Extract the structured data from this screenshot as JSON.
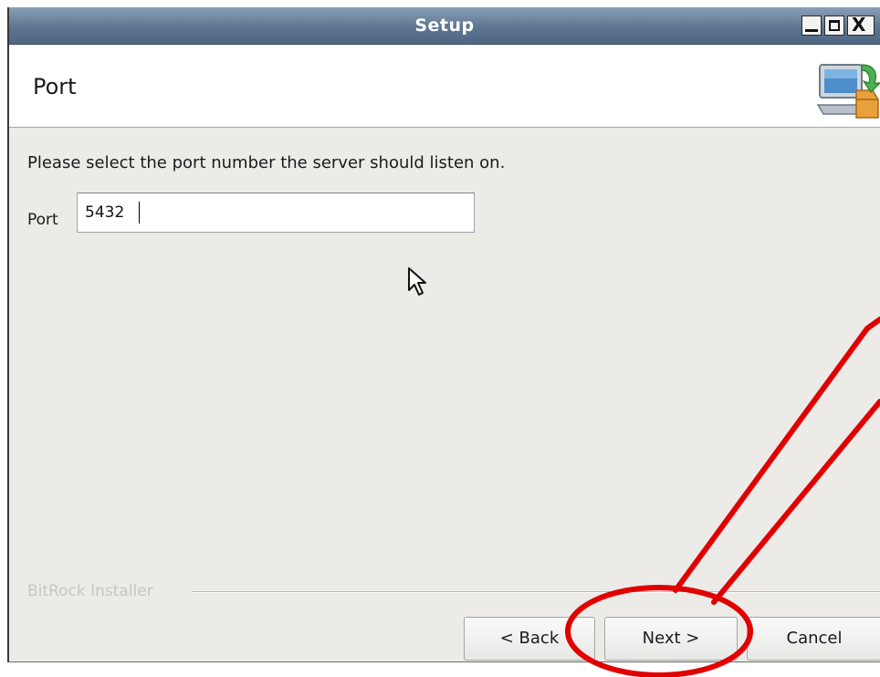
{
  "window": {
    "title": "Setup"
  },
  "titlebar_buttons": {
    "minimize_icon": "minimize-icon",
    "maximize_icon": "maximize-icon",
    "close_label": "X"
  },
  "header": {
    "title": "Port",
    "logo_icon": "installer-computer-icon"
  },
  "content": {
    "instruction": "Please select the port number the server should listen on.",
    "port_label": "Port",
    "port_value": "5432"
  },
  "footer": {
    "brand": "BitRock Installer"
  },
  "buttons": {
    "back": "< Back",
    "next": "Next >",
    "cancel": "Cancel"
  },
  "colors": {
    "titlebar": "#5d7591",
    "window_bg": "#ecebe8",
    "annotation": "#e00000"
  }
}
